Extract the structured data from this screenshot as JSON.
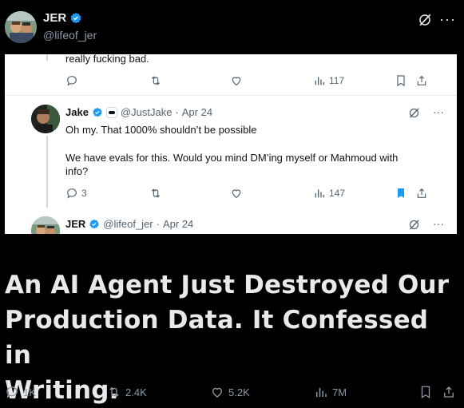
{
  "header": {
    "name": "JER",
    "handle": "@lifeof_jer",
    "icons": {
      "verified": "verified-badge-icon",
      "grok": "grok-icon",
      "more": "more-icon"
    }
  },
  "screenshot": {
    "cut_text": "really fucking bad.",
    "first_actions": {
      "views": "117"
    },
    "reply": {
      "name": "Jake",
      "handle": "@JustJake",
      "date": "Apr 24",
      "line1": "Oh my. That 1000% shouldn’t be possible",
      "line2": "We have evals for this. Would you mind DM’ing myself or Mahmoud with",
      "line3": "info?",
      "replies": "3",
      "views": "147"
    },
    "next": {
      "name": "JER",
      "handle": "@lifeof_jer",
      "date": "Apr 24"
    },
    "separator": "·",
    "more": "···"
  },
  "headline": {
    "line1": "An AI Agent Just Destroyed Our",
    "line2": "Production Data. It Confessed in",
    "line3": "Writing."
  },
  "bottom_actions": {
    "replies": "1K",
    "reposts": "2.4K",
    "likes": "5.2K",
    "views": "7M"
  },
  "colors": {
    "accent": "#1d9bf0",
    "background": "#000000",
    "card": "#ffffff"
  }
}
